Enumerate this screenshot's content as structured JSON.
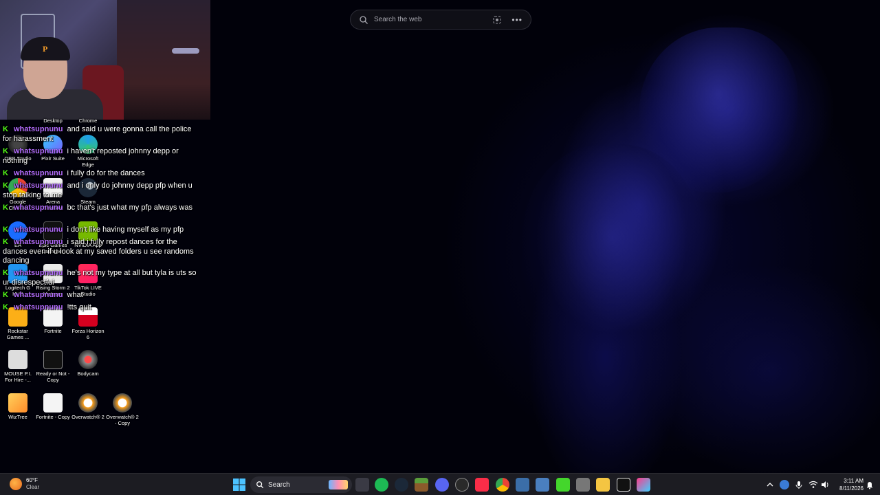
{
  "web_search": {
    "placeholder": "Search the web"
  },
  "desktop_icons": [
    {
      "label": "Desktop"
    },
    {
      "label": "Chrome"
    },
    {
      "label": "OBS Studio"
    },
    {
      "label": "Pixlr Suite"
    },
    {
      "label": "Microsoft Edge"
    },
    {
      "label": "Google Chrome"
    },
    {
      "label": "Arena Breakout"
    },
    {
      "label": "Steam"
    },
    {
      "label": "EA"
    },
    {
      "label": "Epic Games Launcher"
    },
    {
      "label": "NVIDIA App"
    },
    {
      "label": "Logitech G HUB"
    },
    {
      "label": "Rising Storm 2 Vietnam"
    },
    {
      "label": "TikTok LIVE Studio"
    },
    {
      "label": "Rockstar Games ..."
    },
    {
      "label": "Fortnite"
    },
    {
      "label": "Forza Horizon 6"
    },
    {
      "label": "MOUSE P.I. For Hire -..."
    },
    {
      "label": "Ready or Not - Copy"
    },
    {
      "label": "Bodycam"
    },
    {
      "label": "WizTree"
    },
    {
      "label": "Fortnite - Copy"
    },
    {
      "label": "Overwatch® 2"
    },
    {
      "label": "Overwatch® 2 - Copy"
    }
  ],
  "chat": {
    "messages": [
      {
        "user": "whatsupnunu",
        "text": "and said u were gonna call the police for harassment"
      },
      {
        "user": "whatsupnunu",
        "text": "i haven't reposted johnny depp or nothing"
      },
      {
        "user": "whatsupnunu",
        "text": "i fully do for the dances"
      },
      {
        "user": "whatsupnunu",
        "text": "and i only do johnny depp pfp when u stop talking to me"
      },
      {
        "user": "whatsupnunu",
        "text": "bc that's just what my pfp always was"
      },
      {
        "user": "whatsupnunu",
        "text": "i don't like having myself as my pfp"
      },
      {
        "user": "whatsupnunu",
        "text": "i said i fully repost dances for the dances even if u look at my saved folders u see randoms dancing"
      },
      {
        "user": "whatsupnunu",
        "text": "he's not my type at all but tyla is uts so ur disrespectful"
      },
      {
        "user": "whatsupnunu",
        "text": "what"
      },
      {
        "user": "whatsupnunu",
        "text": "!tts quit"
      }
    ]
  },
  "taskbar": {
    "weather_temp": "60°F",
    "weather_condition": "Clear",
    "search_label": "Search",
    "clock_time": "3:11 AM",
    "clock_date": "8/11/2026",
    "pinned_apps": [
      {
        "icon": "task-view-icon"
      },
      {
        "icon": "spotify-icon"
      },
      {
        "icon": "steam-icon"
      },
      {
        "icon": "minecraft-icon"
      },
      {
        "icon": "discord-icon"
      },
      {
        "icon": "obs-icon"
      },
      {
        "icon": "apple-music-icon"
      },
      {
        "icon": "chrome-icon"
      },
      {
        "icon": "window-app-icon"
      },
      {
        "icon": "window-app-2-icon"
      },
      {
        "icon": "razer-icon"
      },
      {
        "icon": "blank-app-icon"
      },
      {
        "icon": "file-explorer-icon"
      },
      {
        "icon": "forza-icon"
      },
      {
        "icon": "snipping-tool-icon"
      }
    ]
  },
  "colors": {
    "chat_username": "#b46cff",
    "kick_badge": "#53fc18",
    "taskbar_bg": "#1c1c22"
  }
}
